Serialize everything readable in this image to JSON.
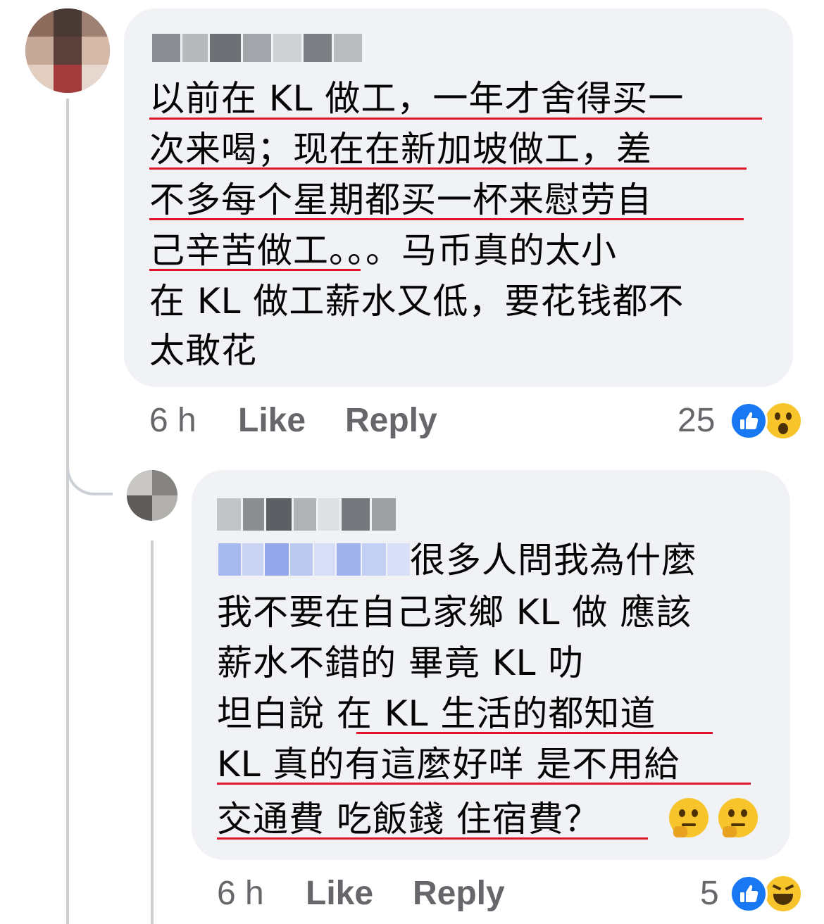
{
  "comment1": {
    "author_name": "",
    "lines": [
      "以前在 KL 做工，一年才舍得买一",
      "次来喝；现在在新加坡做工，差",
      "不多每个星期都买一杯来慰劳自",
      "己辛苦做工。。。马币真的太小",
      "在 KL 做工薪水又低，要花钱都不",
      "太敢花"
    ],
    "time": "6 h",
    "like_label": "Like",
    "reply_label": "Reply",
    "reaction_count": "25",
    "reactions": [
      "like-icon",
      "wow-emoji"
    ]
  },
  "comment2": {
    "author_name": "",
    "mention": "",
    "lines": [
      "很多人問我為什麼",
      "我不要在自己家鄉 KL 做 應該",
      "薪水不錯的 畢竟 KL 叻",
      "坦白說 在 KL 生活的都知道",
      "KL 真的有這麼好咩 是不用給",
      "交通費 吃飯錢 住宿費？"
    ],
    "trailing_emojis": [
      "thinking-face-emoji",
      "thinking-face-emoji"
    ],
    "time": "6 h",
    "like_label": "Like",
    "reply_label": "Reply",
    "reaction_count": "5",
    "reactions": [
      "like-icon",
      "laughing-emoji"
    ]
  },
  "colors": {
    "bubble": "#f0f2f5",
    "meta_text": "#65676b",
    "underline": "#e0132a",
    "like_blue": "#1877f2",
    "emoji_yellow": "#f7c42c"
  }
}
